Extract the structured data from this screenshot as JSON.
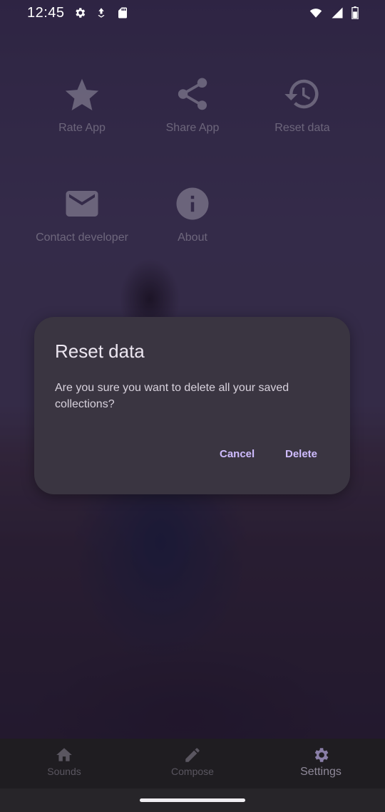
{
  "status_bar": {
    "time": "12:45",
    "left_icons": [
      "settings-icon",
      "download-icon",
      "sd-card-icon"
    ],
    "right_icons": [
      "wifi-icon",
      "signal-icon",
      "battery-icon"
    ]
  },
  "settings_grid": {
    "items": [
      {
        "label": "Rate App",
        "icon": "star-icon"
      },
      {
        "label": "Share App",
        "icon": "share-icon"
      },
      {
        "label": "Reset data",
        "icon": "history-icon"
      },
      {
        "label": "Contact developer",
        "icon": "mail-icon"
      },
      {
        "label": "About",
        "icon": "info-icon"
      }
    ]
  },
  "dialog": {
    "title": "Reset data",
    "message": "Are you sure you want to delete all your saved collections?",
    "cancel_label": "Cancel",
    "delete_label": "Delete",
    "accent_color": "#cfbcff",
    "background_color": "#3a3541"
  },
  "bottom_nav": {
    "items": [
      {
        "label": "Sounds",
        "icon": "home-icon",
        "active": false
      },
      {
        "label": "Compose",
        "icon": "pencil-icon",
        "active": false
      },
      {
        "label": "Settings",
        "icon": "gear-icon",
        "active": true
      }
    ]
  }
}
